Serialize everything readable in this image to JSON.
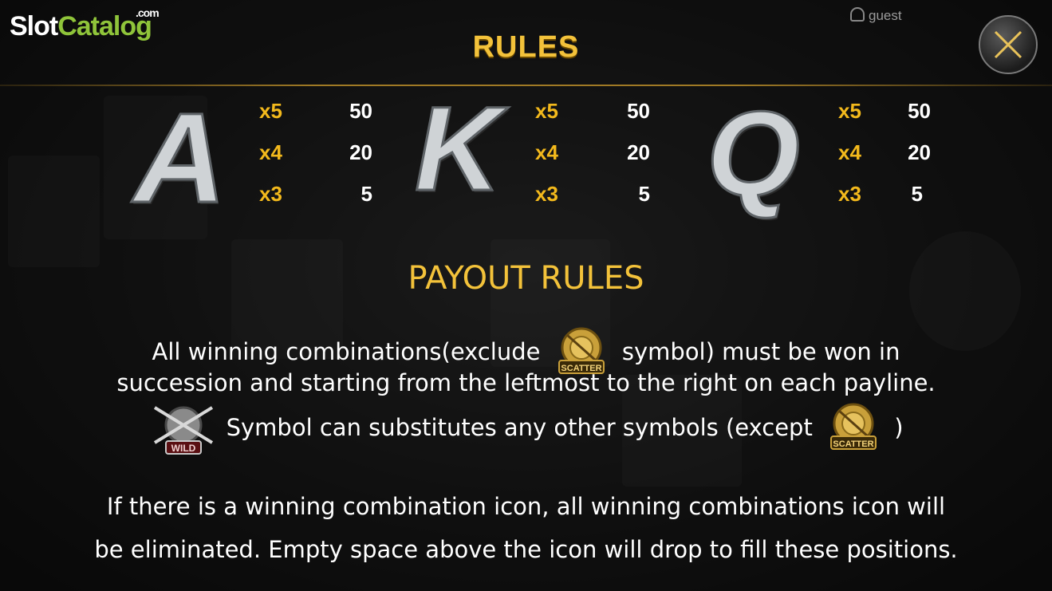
{
  "watermark": {
    "part1": "Slot",
    "part2": "Catalog",
    "part3": ".com"
  },
  "header": {
    "user": "guest",
    "title": "RULES"
  },
  "paytable": [
    {
      "symbol": "A",
      "rows": [
        {
          "mult": "x5",
          "value": "50"
        },
        {
          "mult": "x4",
          "value": "20"
        },
        {
          "mult": "x3",
          "value": "5"
        }
      ]
    },
    {
      "symbol": "K",
      "rows": [
        {
          "mult": "x5",
          "value": "50"
        },
        {
          "mult": "x4",
          "value": "20"
        },
        {
          "mult": "x3",
          "value": "5"
        }
      ]
    },
    {
      "symbol": "Q",
      "rows": [
        {
          "mult": "x5",
          "value": "50"
        },
        {
          "mult": "x4",
          "value": "20"
        },
        {
          "mult": "x3",
          "value": "5"
        }
      ]
    }
  ],
  "payout": {
    "heading": "PAYOUT RULES",
    "line1_a": "All winning combinations(exclude",
    "line1_b": "symbol) must be won in",
    "line2": "succession and starting from the leftmost to the right on each payline.",
    "line3_a": "Symbol can substitutes any other symbols (except",
    "line3_b": ")",
    "line4": "If there is a winning combination icon, all winning combinations icon will",
    "line5": "be eliminated. Empty space above the icon will drop to fill these positions.",
    "scatter_label": "SCATTER",
    "wild_label": "WILD"
  },
  "colors": {
    "gold": "#f3c23a",
    "text": "#ffffff",
    "green": "#8fc43a"
  },
  "icons": {
    "close": "close-x-icon",
    "scatter": "scatter-medal-icon",
    "wild": "wild-crossed-rifles-icon",
    "user": "user-icon"
  }
}
